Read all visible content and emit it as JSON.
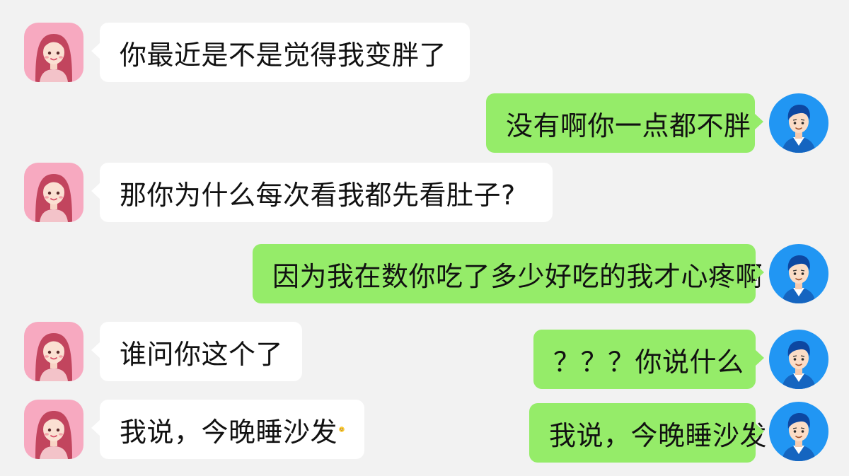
{
  "chat": {
    "messages": [
      {
        "side": "left",
        "sender": "girlfriend",
        "text": "你最近是不是觉得我变胖了"
      },
      {
        "side": "right",
        "sender": "boyfriend",
        "text": "没有啊你一点都不胖"
      },
      {
        "side": "left",
        "sender": "girlfriend",
        "text": "那你为什么每次看我都先看肚子?"
      },
      {
        "side": "right",
        "sender": "boyfriend",
        "text": "因为我在数你吃了多少好吃的我才心疼啊"
      },
      {
        "side": "left",
        "sender": "girlfriend",
        "text": "谁问你这个了"
      },
      {
        "side": "right",
        "sender": "boyfriend",
        "text": "？？？你说什么"
      },
      {
        "side": "left",
        "sender": "girlfriend",
        "text": "我说，今晚睡沙发",
        "emoji": "grinning-face-emoji"
      },
      {
        "side": "right",
        "sender": "boyfriend",
        "text": "我说，今晚睡沙发"
      }
    ]
  },
  "colors": {
    "background": "#f2f2f2",
    "incoming_bubble": "#ffffff",
    "outgoing_bubble": "#95ec69",
    "female_avatar_bg": "#f7a9c0",
    "male_avatar_bg": "#2196f3"
  },
  "icons": {
    "female_avatar": "woman-avatar-icon",
    "male_avatar": "man-avatar-icon"
  }
}
